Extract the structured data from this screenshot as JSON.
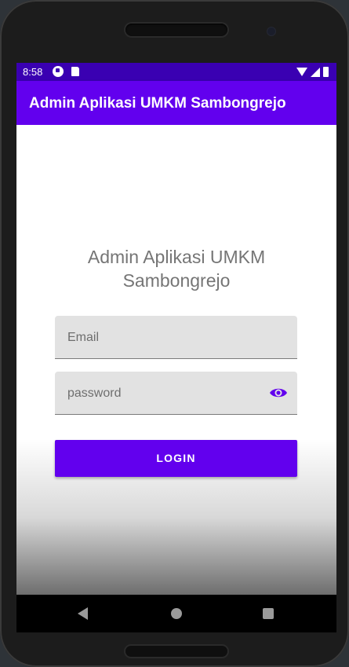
{
  "status_bar": {
    "time": "8:58"
  },
  "app_bar": {
    "title": "Admin Aplikasi UMKM Sambongrejo"
  },
  "login_form": {
    "heading": "Admin Aplikasi UMKM Sambongrejo",
    "email_placeholder": "Email",
    "password_placeholder": "password",
    "login_label": "LOGIN"
  },
  "colors": {
    "primary": "#6200ee",
    "primary_dark": "#3a00b2",
    "field_bg": "#e2e2e2",
    "heading_text": "#757575"
  },
  "icons": {
    "password_toggle": "eye-icon",
    "nav_back": "back-triangle-icon",
    "nav_home": "home-circle-icon",
    "nav_recents": "recents-square-icon"
  }
}
